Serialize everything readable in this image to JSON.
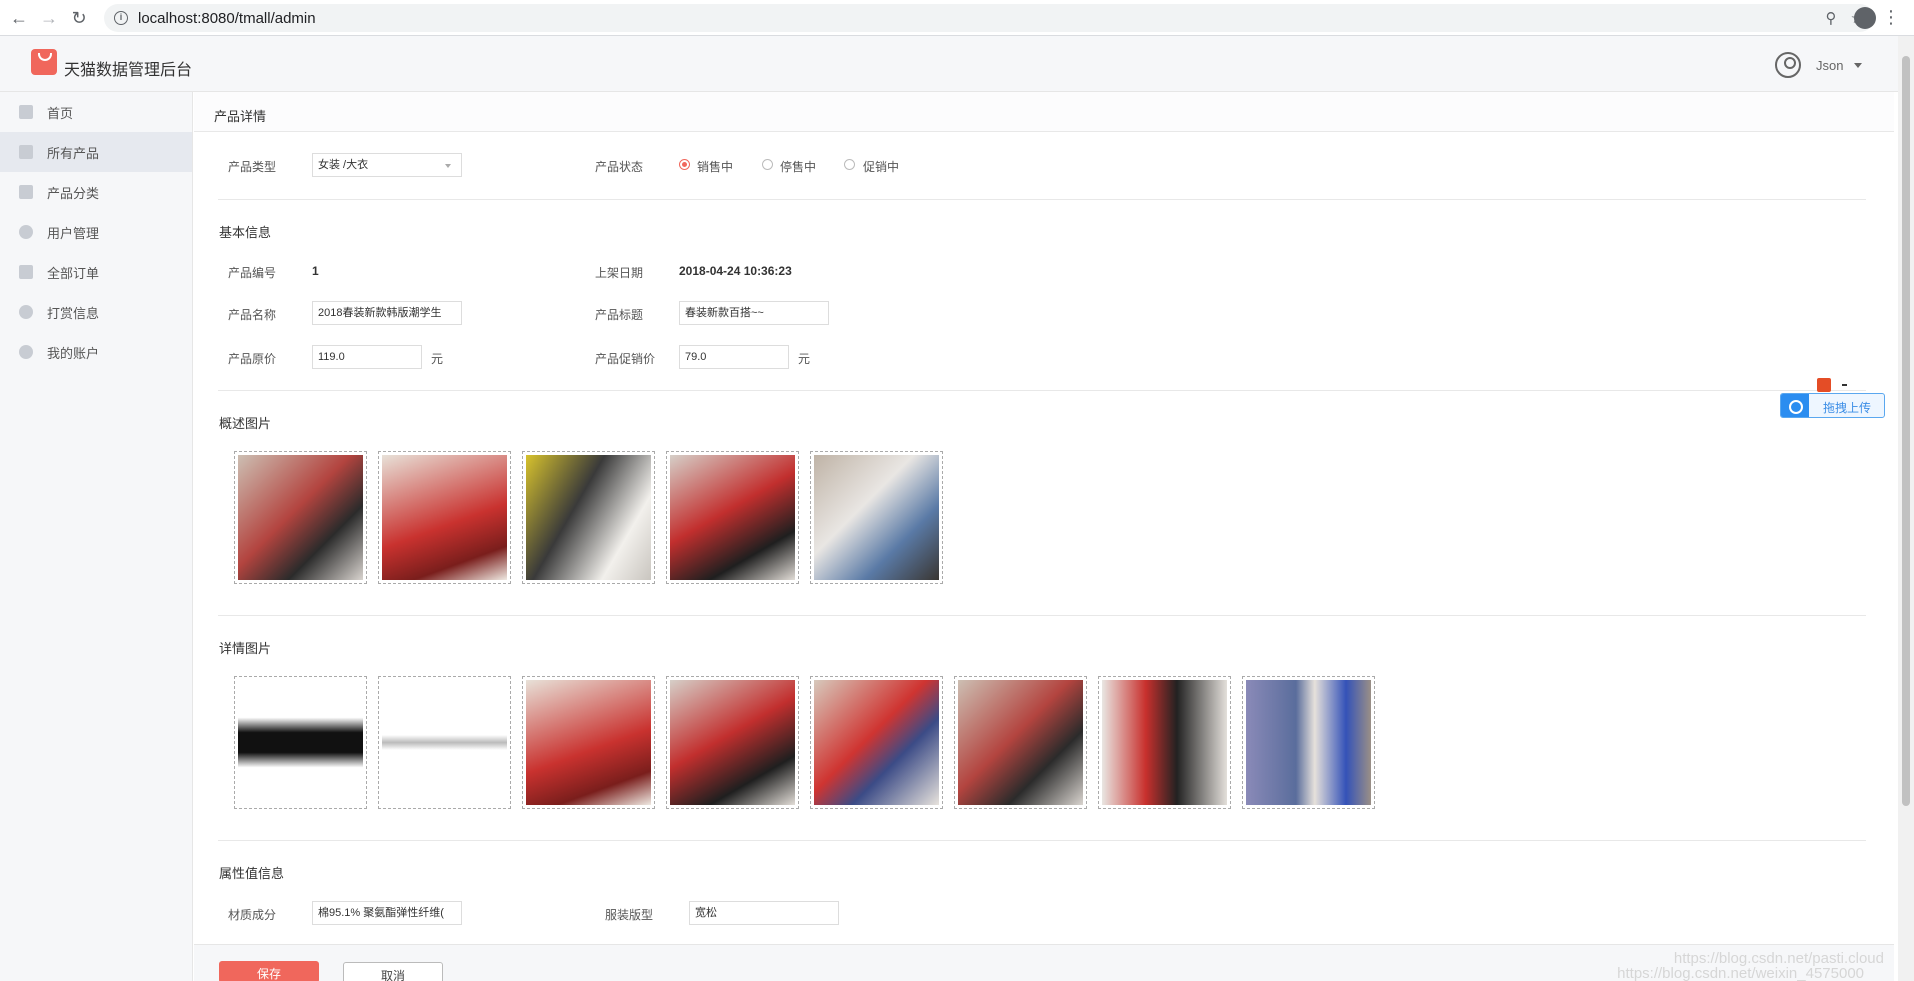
{
  "browser": {
    "url": "localhost:8080/tmall/admin"
  },
  "header": {
    "title": "天猫数据管理后台",
    "username": "Json"
  },
  "sidebar": {
    "items": [
      {
        "label": "首页",
        "icon": "home-icon"
      },
      {
        "label": "所有产品",
        "icon": "product-icon",
        "active": true
      },
      {
        "label": "产品分类",
        "icon": "grid-icon"
      },
      {
        "label": "用户管理",
        "icon": "user-icon"
      },
      {
        "label": "全部订单",
        "icon": "clipboard-icon"
      },
      {
        "label": "打赏信息",
        "icon": "reward-icon"
      },
      {
        "label": "我的账户",
        "icon": "gear-icon"
      }
    ]
  },
  "page": {
    "title": "产品详情"
  },
  "form": {
    "type_label": "产品类型",
    "type_value": "女装 /大衣",
    "status_label": "产品状态",
    "status_options": [
      "销售中",
      "停售中",
      "促销中"
    ],
    "status_selected": "销售中",
    "basic_title": "基本信息",
    "id_label": "产品编号",
    "id_value": "1",
    "date_label": "上架日期",
    "date_value": "2018-04-24 10:36:23",
    "name_label": "产品名称",
    "name_value": "2018春装新款韩版潮学生",
    "subtitle_label": "产品标题",
    "subtitle_value": "春装新款百搭~~",
    "price_label": "产品原价",
    "price_value": "119.0",
    "promo_label": "产品促销价",
    "promo_value": "79.0",
    "unit": "元",
    "summary_title": "概述图片",
    "detail_title": "详情图片",
    "attr_title": "属性值信息",
    "material_label": "材质成分",
    "material_value": "棉95.1% 聚氨酯弹性纤维(",
    "fit_label": "服装版型",
    "fit_value": "宽松",
    "save_label": "保存",
    "cancel_label": "取消"
  },
  "upload_badge": "拖拽上传",
  "watermarks": [
    "https://blog.csdn.net/pasti.cloud",
    "https://blog.csdn.net/weixin_4575000"
  ],
  "colors": {
    "accent": "#f0675c",
    "sidebar_bg": "#f6f7f9",
    "sidebar_active": "#e6e9ef"
  }
}
